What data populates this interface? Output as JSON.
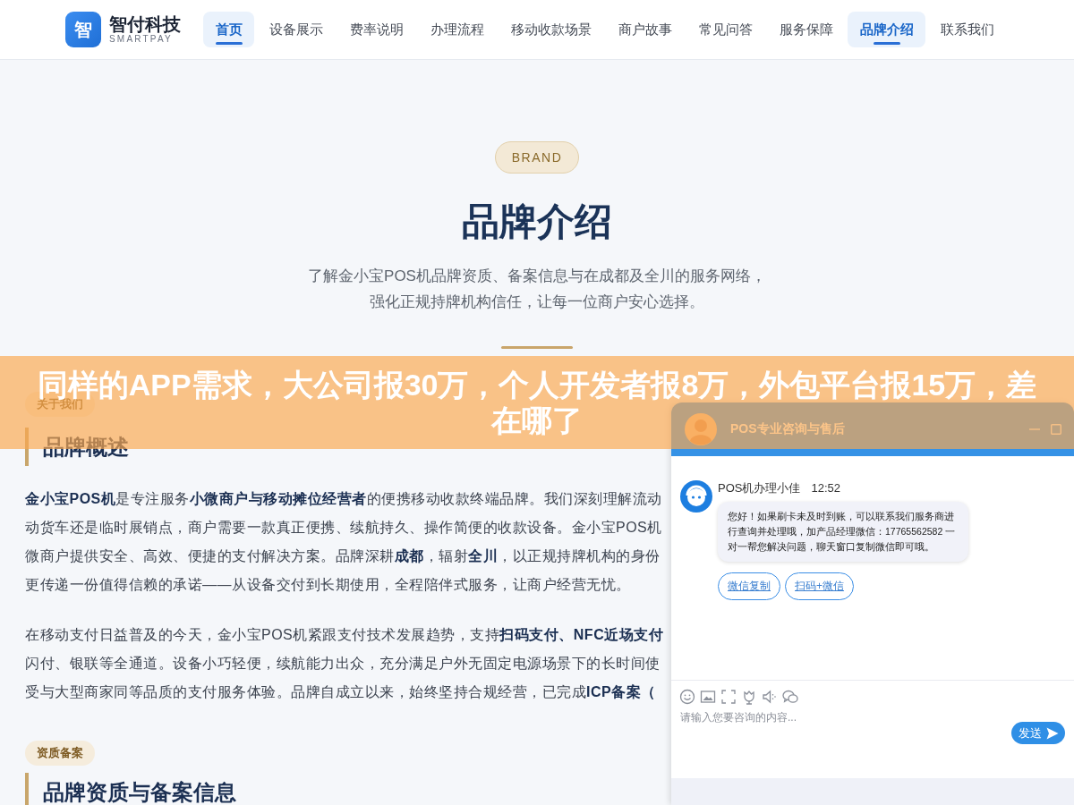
{
  "header": {
    "logo": {
      "mark": "智",
      "name": "智付科技",
      "tagline": "SMARTPAY"
    },
    "nav": [
      {
        "label": "首页",
        "selected": true
      },
      {
        "label": "设备展示",
        "selected": false
      },
      {
        "label": "费率说明",
        "selected": false
      },
      {
        "label": "办理流程",
        "selected": false
      },
      {
        "label": "移动收款场景",
        "selected": false
      },
      {
        "label": "商户故事",
        "selected": false
      },
      {
        "label": "常见问答",
        "selected": false
      },
      {
        "label": "服务保障",
        "selected": false
      },
      {
        "label": "品牌介绍",
        "selected": true
      },
      {
        "label": "联系我们",
        "selected": false
      }
    ]
  },
  "hero": {
    "badge": "BRAND",
    "title": "品牌介绍",
    "subtitle_lines": [
      "了解金小宝POS机品牌资质、备案信息与在成都及全川的服务网络，",
      "强化正规持牌机构信任，让每一位商户安心选择。"
    ]
  },
  "sections": [
    {
      "tag": "关于我们",
      "heading": "品牌概述",
      "paragraphs": [
        {
          "lines": [
            "**金小宝POS机**是专注服务**小微商户与移动摊位经营者**的便携移动收款终端品牌。我们深刻理解流动",
            "动货车还是临时展销点，商户需要一款真正便携、续航持久、操作简便的收款设备。金小宝POS机",
            "微商户提供安全、高效、便捷的支付解决方案。品牌深耕**成都**，辐射**全川**，以正规持牌机构的身份",
            "更传递一份值得信赖的承诺——从设备交付到长期使用，全程陪伴式服务，让商户经营无忧。"
          ]
        },
        {
          "lines": [
            "在移动支付日益普及的今天，金小宝POS机紧跟支付技术发展趋势，支持**扫码支付、NFC近场支付**",
            "闪付、银联等全通道。设备小巧轻便，续航能力出众，充分满足户外无固定电源场景下的长时间使",
            "受与大型商家同等品质的支付服务体验。品牌自成立以来，始终坚持合规经营，已完成**ICP备案（**"
          ]
        }
      ]
    },
    {
      "tag": "资质备案",
      "heading": "品牌资质与备案信息"
    }
  ],
  "banner": {
    "text": "同样的APP需求，大公司报30万，个人开发者报8万，外包平台报15万，差在哪了"
  },
  "chat": {
    "title": "POS专业咨询与售后",
    "messages": [
      {
        "sender": "POS机办理小佳",
        "time": "12:52",
        "text": "您好！如果刷卡未及时到账，可以联系我们服务商进行查询并处理哦，加产品经理微信：17765562582 一对一帮您解决问题，聊天窗口复制微信即可哦。",
        "actions": [
          "微信复制",
          "扫码+微信"
        ]
      }
    ],
    "input": {
      "placeholder": "请输入您要咨询的内容..."
    },
    "send_button": "发送"
  }
}
